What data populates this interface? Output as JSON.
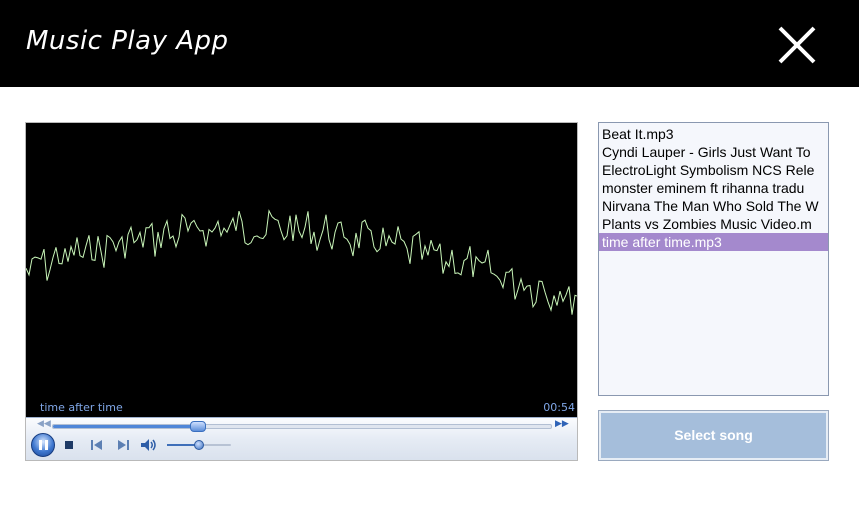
{
  "app": {
    "title": "Music Play App",
    "close_icon": "close-icon"
  },
  "player": {
    "now_playing": "time after time",
    "elapsed": "00:54",
    "seek_progress_fraction": 0.29,
    "volume_fraction": 0.5,
    "state": "playing",
    "waveform_color": "#c8f5b8",
    "accent": "#4f86d8"
  },
  "playlist": {
    "items": [
      "Beat It.mp3",
      "Cyndi Lauper - Girls Just Want To",
      "ElectroLight  Symbolism NCS Rele",
      "monster  eminem ft rihanna  tradu",
      "Nirvana  The Man Who Sold The W",
      "Plants vs Zombies Music Video.m",
      "time after time.mp3"
    ],
    "selected_index": 6,
    "selected_color": "#a489cd"
  },
  "actions": {
    "select_song_label": "Select song"
  }
}
